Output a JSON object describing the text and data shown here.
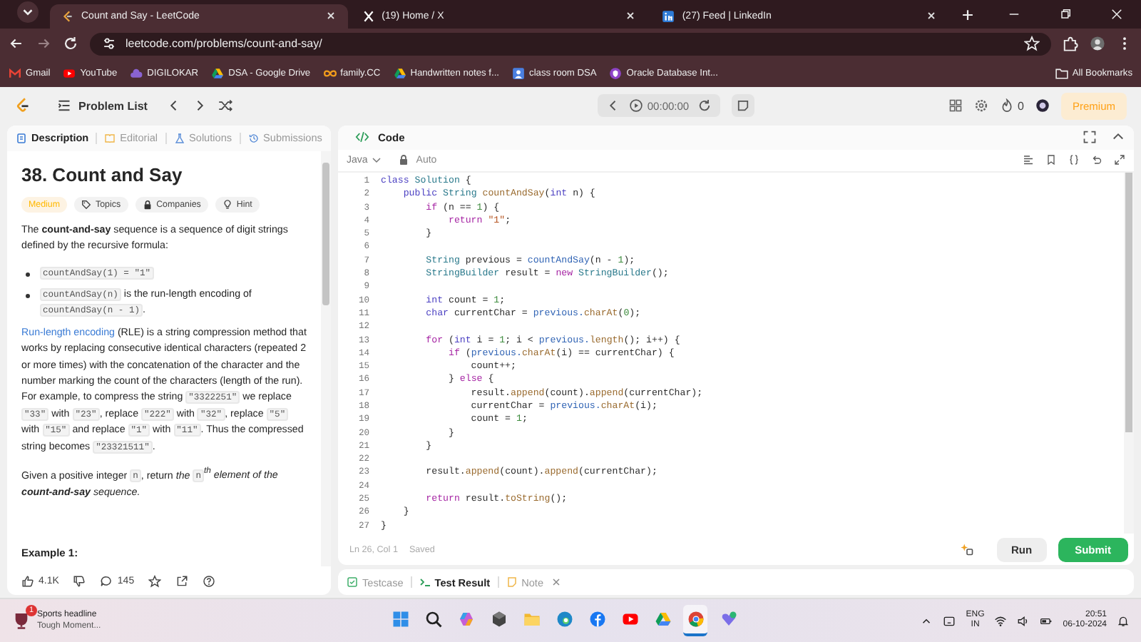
{
  "browser": {
    "tabs": [
      {
        "kind": "leetcode",
        "title": "Count and Say - LeetCode",
        "selected": true
      },
      {
        "kind": "x",
        "title": "(19) Home / X",
        "selected": false
      },
      {
        "kind": "linkedin",
        "title": "(27) Feed | LinkedIn",
        "selected": false
      }
    ],
    "address": "leetcode.com/problems/count-and-say/",
    "bookmarks": [
      {
        "kind": "gmail",
        "label": "Gmail"
      },
      {
        "kind": "youtube",
        "label": "YouTube"
      },
      {
        "kind": "cloud",
        "label": "DIGILOKAR"
      },
      {
        "kind": "drive",
        "label": "DSA - Google Drive"
      },
      {
        "kind": "infinity",
        "label": "family.CC"
      },
      {
        "kind": "drive",
        "label": "Handwritten notes f..."
      },
      {
        "kind": "person",
        "label": "class room DSA"
      },
      {
        "kind": "oracle",
        "label": "Oracle Database Int..."
      }
    ],
    "all_bookmarks": "All Bookmarks"
  },
  "header": {
    "problem_list": "Problem List",
    "timer": "00:00:00",
    "streak": "0",
    "premium": "Premium"
  },
  "description": {
    "tabs": [
      {
        "kind": "doc",
        "label": "Description",
        "selected": true
      },
      {
        "kind": "book",
        "label": "Editorial",
        "selected": false
      },
      {
        "kind": "flask",
        "label": "Solutions",
        "selected": false
      },
      {
        "kind": "clock",
        "label": "Submissions",
        "selected": false
      }
    ],
    "title": "38. Count and Say",
    "tags": [
      {
        "kind": "difficulty",
        "label": "Medium"
      },
      {
        "kind": "tag",
        "label": "Topics"
      },
      {
        "kind": "lock",
        "label": "Companies"
      },
      {
        "kind": "bulb",
        "label": "Hint"
      }
    ],
    "blocks": [
      {
        "kind": "paragraph",
        "segments": [
          {
            "kind": "text",
            "text": "The **count-and-say** sequence is a sequence of digit strings defined by the recursive formula:"
          }
        ]
      },
      {
        "kind": "bullet",
        "segments": [
          {
            "kind": "code",
            "text": "countAndSay(1) = \"1\""
          }
        ]
      },
      {
        "kind": "bullet",
        "segments": [
          {
            "kind": "code",
            "text": "countAndSay(n)"
          },
          {
            "kind": "text",
            "text": " is the run-length encoding of "
          },
          {
            "kind": "code",
            "text": "countAndSay(n - 1)"
          },
          {
            "kind": "text",
            "text": "."
          }
        ]
      },
      {
        "kind": "paragraph",
        "segments": [
          {
            "kind": "link",
            "text": "Run-length encoding"
          },
          {
            "kind": "text",
            "text": " (RLE) is a string compression method that works by replacing consecutive identical characters (repeated 2 or more times) with the concatenation of the character and the number marking the count of the characters (length of the run). For example, to compress the string "
          },
          {
            "kind": "code",
            "text": "\"3322251\""
          },
          {
            "kind": "text",
            "text": " we replace "
          },
          {
            "kind": "code",
            "text": "\"33\""
          },
          {
            "kind": "text",
            "text": " with "
          },
          {
            "kind": "code",
            "text": "\"23\""
          },
          {
            "kind": "text",
            "text": ", replace "
          },
          {
            "kind": "code",
            "text": "\"222\""
          },
          {
            "kind": "text",
            "text": " with "
          },
          {
            "kind": "code",
            "text": "\"32\""
          },
          {
            "kind": "text",
            "text": ", replace "
          },
          {
            "kind": "code",
            "text": "\"5\""
          },
          {
            "kind": "text",
            "text": " with "
          },
          {
            "kind": "code",
            "text": "\"15\""
          },
          {
            "kind": "text",
            "text": " and replace "
          },
          {
            "kind": "code",
            "text": "\"1\""
          },
          {
            "kind": "text",
            "text": " with "
          },
          {
            "kind": "code",
            "text": "\"11\""
          },
          {
            "kind": "text",
            "text": ". Thus the compressed string becomes "
          },
          {
            "kind": "code",
            "text": "\"23321511\""
          },
          {
            "kind": "text",
            "text": "."
          }
        ]
      },
      {
        "kind": "paragraph",
        "segments": [
          {
            "kind": "text",
            "text": "Given a positive integer "
          },
          {
            "kind": "code",
            "text": "n"
          },
          {
            "kind": "text",
            "text": ", return "
          },
          {
            "kind": "em",
            "text": "the "
          },
          {
            "kind": "code",
            "text": "n"
          },
          {
            "kind": "em",
            "text": "$^{th}$ element of the **count-and-say** sequence."
          }
        ]
      }
    ],
    "example": "Example 1:",
    "likes": "4.1K",
    "comments": "145"
  },
  "editor": {
    "title": "Code",
    "language": "Java",
    "mode": "Auto",
    "lines": [
      {
        "number": "1",
        "tokens": [
          {
            "kind": "keyword",
            "text": "class"
          },
          {
            "kind": "type",
            "text": " Solution"
          },
          {
            "kind": "plain",
            "text": " {"
          }
        ]
      },
      {
        "number": "2",
        "tokens": [
          {
            "kind": "keyword",
            "text": "    public"
          },
          {
            "kind": "type",
            "text": " String"
          },
          {
            "kind": "method",
            "text": " countAndSay"
          },
          {
            "kind": "plain",
            "text": "("
          },
          {
            "kind": "keyword",
            "text": "int"
          },
          {
            "kind": "plain",
            "text": " n) {"
          }
        ]
      },
      {
        "number": "3",
        "tokens": [
          {
            "kind": "control",
            "text": "        if"
          },
          {
            "kind": "plain",
            "text": " (n == "
          },
          {
            "kind": "number",
            "text": "1"
          },
          {
            "kind": "plain",
            "text": ") {"
          }
        ]
      },
      {
        "number": "4",
        "tokens": [
          {
            "kind": "control",
            "text": "            return"
          },
          {
            "kind": "string",
            "text": " \"1\""
          },
          {
            "kind": "plain",
            "text": ";"
          }
        ]
      },
      {
        "number": "5",
        "tokens": [
          {
            "kind": "plain",
            "text": "        }"
          }
        ]
      },
      {
        "number": "6"
      },
      {
        "number": "7",
        "tokens": [
          {
            "kind": "type",
            "text": "        String"
          },
          {
            "kind": "plain",
            "text": " previous = "
          },
          {
            "kind": "call",
            "text": "countAndSay"
          },
          {
            "kind": "plain",
            "text": "(n - "
          },
          {
            "kind": "number",
            "text": "1"
          },
          {
            "kind": "plain",
            "text": ");"
          }
        ]
      },
      {
        "number": "8",
        "tokens": [
          {
            "kind": "type",
            "text": "        StringBuilder"
          },
          {
            "kind": "plain",
            "text": " result = "
          },
          {
            "kind": "control",
            "text": "new"
          },
          {
            "kind": "type",
            "text": " StringBuilder"
          },
          {
            "kind": "plain",
            "text": "();"
          }
        ]
      },
      {
        "number": "9"
      },
      {
        "number": "10",
        "tokens": [
          {
            "kind": "keyword",
            "text": "        int"
          },
          {
            "kind": "plain",
            "text": " count = "
          },
          {
            "kind": "number",
            "text": "1"
          },
          {
            "kind": "plain",
            "text": ";"
          }
        ]
      },
      {
        "number": "11",
        "tokens": [
          {
            "kind": "keyword",
            "text": "        char"
          },
          {
            "kind": "plain",
            "text": " currentChar = "
          },
          {
            "kind": "call",
            "text": "previous."
          },
          {
            "kind": "method",
            "text": "charAt"
          },
          {
            "kind": "plain",
            "text": "("
          },
          {
            "kind": "number",
            "text": "0"
          },
          {
            "kind": "plain",
            "text": ");"
          }
        ]
      },
      {
        "number": "12"
      },
      {
        "number": "13",
        "tokens": [
          {
            "kind": "control",
            "text": "        for"
          },
          {
            "kind": "plain",
            "text": " ("
          },
          {
            "kind": "keyword",
            "text": "int"
          },
          {
            "kind": "plain",
            "text": " i = "
          },
          {
            "kind": "number",
            "text": "1"
          },
          {
            "kind": "plain",
            "text": "; i < "
          },
          {
            "kind": "call",
            "text": "previous."
          },
          {
            "kind": "method",
            "text": "length"
          },
          {
            "kind": "plain",
            "text": "(); i++) {"
          }
        ]
      },
      {
        "number": "14",
        "tokens": [
          {
            "kind": "control",
            "text": "            if"
          },
          {
            "kind": "plain",
            "text": " ("
          },
          {
            "kind": "call",
            "text": "previous."
          },
          {
            "kind": "method",
            "text": "charAt"
          },
          {
            "kind": "plain",
            "text": "(i) == currentChar) {"
          }
        ]
      },
      {
        "number": "15",
        "tokens": [
          {
            "kind": "plain",
            "text": "                count++;"
          }
        ]
      },
      {
        "number": "16",
        "tokens": [
          {
            "kind": "plain",
            "text": "            } "
          },
          {
            "kind": "control",
            "text": "else"
          },
          {
            "kind": "plain",
            "text": " {"
          }
        ]
      },
      {
        "number": "17",
        "tokens": [
          {
            "kind": "plain",
            "text": "                result."
          },
          {
            "kind": "method",
            "text": "append"
          },
          {
            "kind": "plain",
            "text": "(count)."
          },
          {
            "kind": "method",
            "text": "append"
          },
          {
            "kind": "plain",
            "text": "(currentChar);"
          }
        ]
      },
      {
        "number": "18",
        "tokens": [
          {
            "kind": "plain",
            "text": "                currentChar = "
          },
          {
            "kind": "call",
            "text": "previous."
          },
          {
            "kind": "method",
            "text": "charAt"
          },
          {
            "kind": "plain",
            "text": "(i);"
          }
        ]
      },
      {
        "number": "19",
        "tokens": [
          {
            "kind": "plain",
            "text": "                count = "
          },
          {
            "kind": "number",
            "text": "1"
          },
          {
            "kind": "plain",
            "text": ";"
          }
        ]
      },
      {
        "number": "20",
        "tokens": [
          {
            "kind": "plain",
            "text": "            }"
          }
        ]
      },
      {
        "number": "21",
        "tokens": [
          {
            "kind": "plain",
            "text": "        }"
          }
        ]
      },
      {
        "number": "22"
      },
      {
        "number": "23",
        "tokens": [
          {
            "kind": "plain",
            "text": "        result."
          },
          {
            "kind": "method",
            "text": "append"
          },
          {
            "kind": "plain",
            "text": "(count)."
          },
          {
            "kind": "method",
            "text": "append"
          },
          {
            "kind": "plain",
            "text": "(currentChar);"
          }
        ]
      },
      {
        "number": "24"
      },
      {
        "number": "25",
        "tokens": [
          {
            "kind": "control",
            "text": "        return"
          },
          {
            "kind": "plain",
            "text": " result."
          },
          {
            "kind": "method",
            "text": "toString"
          },
          {
            "kind": "plain",
            "text": "();"
          }
        ]
      },
      {
        "number": "26",
        "tokens": [
          {
            "kind": "plain",
            "text": "    }"
          }
        ]
      },
      {
        "number": "27",
        "tokens": [
          {
            "kind": "plain",
            "text": "}"
          }
        ]
      }
    ],
    "position": "Ln 26, Col 1",
    "saved": "Saved",
    "run": "Run",
    "submit": "Submit",
    "bottom_tabs": [
      {
        "kind": "check",
        "label": "Testcase",
        "selected": false,
        "closable": false
      },
      {
        "kind": "terminal",
        "label": "Test Result",
        "selected": true,
        "closable": false
      },
      {
        "kind": "note",
        "label": "Note",
        "selected": false,
        "closable": true
      }
    ]
  },
  "taskbar": {
    "news_title": "Sports headline",
    "news_subtitle": "Tough Moment...",
    "badge": "1",
    "apps": [
      {
        "kind": "start",
        "selected": false
      },
      {
        "kind": "search",
        "selected": false
      },
      {
        "kind": "copilot",
        "selected": false
      },
      {
        "kind": "cube",
        "selected": false
      },
      {
        "kind": "folder",
        "selected": false
      },
      {
        "kind": "edge",
        "selected": false
      },
      {
        "kind": "facebook",
        "selected": false
      },
      {
        "kind": "youtube",
        "selected": false
      },
      {
        "kind": "drive",
        "selected": false
      },
      {
        "kind": "chrome",
        "selected": true
      },
      {
        "kind": "vpn",
        "selected": false
      }
    ],
    "language": "ENG",
    "region": "IN",
    "time": "20:51",
    "date": "06-10-2024"
  }
}
